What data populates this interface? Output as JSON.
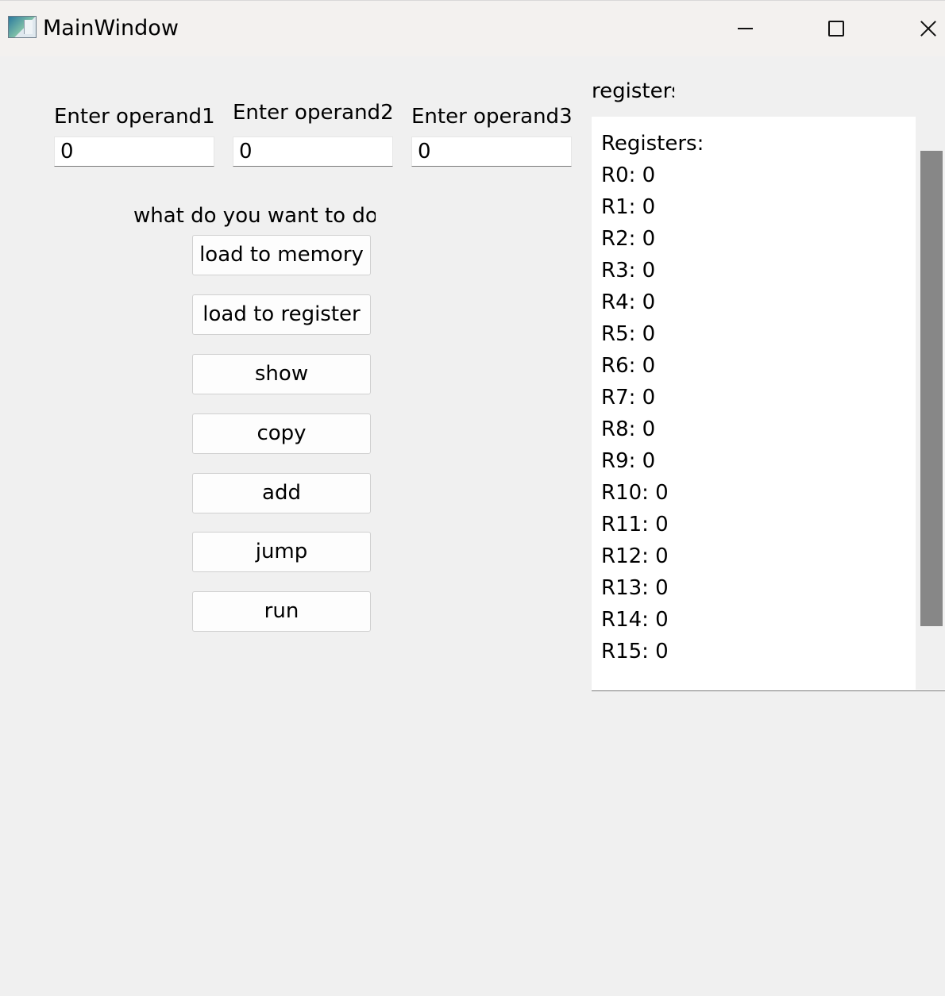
{
  "window": {
    "title": "MainWindow"
  },
  "operands": [
    {
      "label": "Enter operand1",
      "value": "0"
    },
    {
      "label": "Enter operand2",
      "value": "0"
    },
    {
      "label": "Enter operand3",
      "value": "0"
    }
  ],
  "actions": {
    "prompt": "what do you want to do",
    "buttons": [
      "load to memory",
      "load to register",
      "show",
      "copy",
      "add",
      "jump",
      "run"
    ]
  },
  "registers_panel": {
    "label": "registers",
    "lines": [
      "Registers:",
      "R0: 0",
      "R1: 0",
      "R2: 0",
      "R3: 0",
      "R4: 0",
      "R5: 0",
      "R6: 0",
      "R7: 0",
      "R8: 0",
      "R9: 0",
      "R10: 0",
      "R11: 0",
      "R12: 0",
      "R13: 0",
      "R14: 0",
      "R15: 0"
    ]
  }
}
